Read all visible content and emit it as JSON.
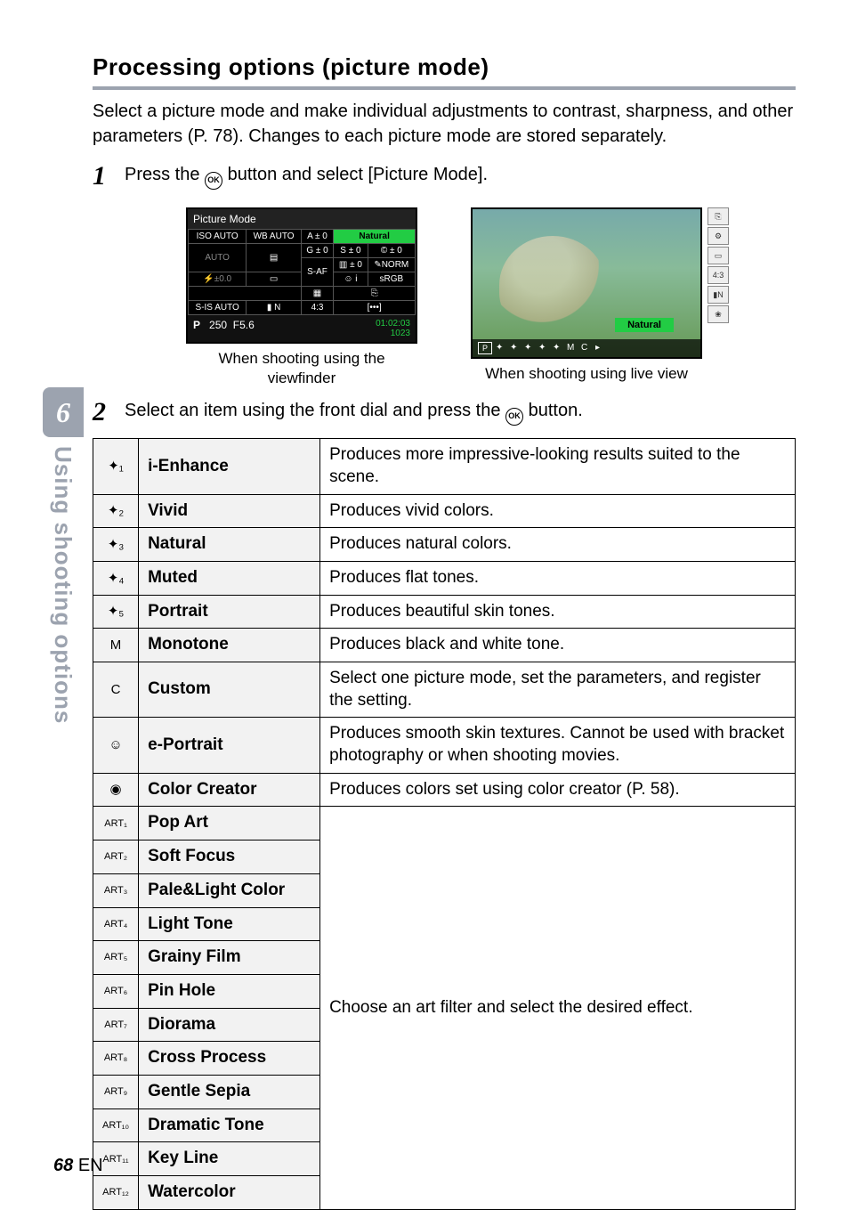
{
  "chapter_num": "6",
  "side_label": "Using shooting options",
  "heading": "Processing options (picture mode)",
  "intro": "Select a picture mode and make individual adjustments to contrast, sharpness, and other parameters (P. 78). Changes to each picture mode are stored separately.",
  "step1_pre": "Press the ",
  "step1_post": " button and select [Picture Mode].",
  "ok_label": "OK",
  "lcd": {
    "title": "Picture Mode",
    "cells": {
      "iso": "ISO\nAUTO",
      "wb": "WB\nAUTO",
      "a0": "A ± 0",
      "g0": "G ± 0",
      "nat": "Natural",
      "auto_flash": "AUTO",
      "hist": "▤",
      "saf": "S-AF",
      "s0": "S ± 0",
      "c0": "© ± 0",
      "mf0": "▥ ± 0",
      "norm": "✎NORM",
      "face": "☺ i",
      "srgb": "sRGB",
      "fpm": "⚡±0.0",
      "rect": "▭",
      "grid": "▦",
      "doc": "⎘",
      "sis": "S-IS AUTO",
      "ln": "▮ N",
      "ar": "4:3",
      "dots": "[•••]"
    },
    "bar_p": "P",
    "bar_sh": "250",
    "bar_ap": "F5.6",
    "bar_time": "01:02:03",
    "bar_shots": "1023"
  },
  "caption_left": "When shooting using the viewfinder",
  "live": {
    "label": "Natural",
    "p": "P",
    "side_icons": [
      "⎘",
      "⚙",
      "▭",
      "4:3",
      "▮N",
      "❀"
    ]
  },
  "caption_right": "When shooting using live view",
  "step2_pre": "Select an item using the front dial and press the ",
  "step2_post": " button.",
  "rows": [
    {
      "icon": "✦₁",
      "name": "i-Enhance",
      "desc": "Produces more impressive-looking results suited to the scene."
    },
    {
      "icon": "✦₂",
      "name": "Vivid",
      "desc": "Produces vivid colors."
    },
    {
      "icon": "✦₃",
      "name": "Natural",
      "desc": "Produces natural colors."
    },
    {
      "icon": "✦₄",
      "name": "Muted",
      "desc": "Produces flat tones."
    },
    {
      "icon": "✦₅",
      "name": "Portrait",
      "desc": "Produces beautiful skin tones."
    },
    {
      "icon": "M",
      "name": "Monotone",
      "desc": "Produces black and white tone."
    },
    {
      "icon": "C",
      "name": "Custom",
      "desc": "Select one picture mode, set the parameters, and register the setting."
    },
    {
      "icon": "☺",
      "name": "e-Portrait",
      "desc": "Produces smooth skin textures. Cannot be used with bracket photography or when shooting movies."
    },
    {
      "icon": "◉",
      "name": "Color Creator",
      "desc": "Produces colors set using color creator (P. 58)."
    }
  ],
  "art_rows": [
    {
      "icon": "ART₁",
      "name": "Pop Art"
    },
    {
      "icon": "ART₂",
      "name": "Soft Focus"
    },
    {
      "icon": "ART₃",
      "name": "Pale&Light Color"
    },
    {
      "icon": "ART₄",
      "name": "Light Tone"
    },
    {
      "icon": "ART₅",
      "name": "Grainy Film"
    },
    {
      "icon": "ART₆",
      "name": "Pin Hole"
    },
    {
      "icon": "ART₇",
      "name": "Diorama"
    },
    {
      "icon": "ART₈",
      "name": "Cross Process"
    },
    {
      "icon": "ART₉",
      "name": "Gentle Sepia"
    },
    {
      "icon": "ART₁₀",
      "name": "Dramatic Tone"
    },
    {
      "icon": "ART₁₁",
      "name": "Key Line"
    },
    {
      "icon": "ART₁₂",
      "name": "Watercolor"
    }
  ],
  "art_desc": "Choose an art filter and select the desired effect.",
  "page_num": "68",
  "page_lang": "EN"
}
